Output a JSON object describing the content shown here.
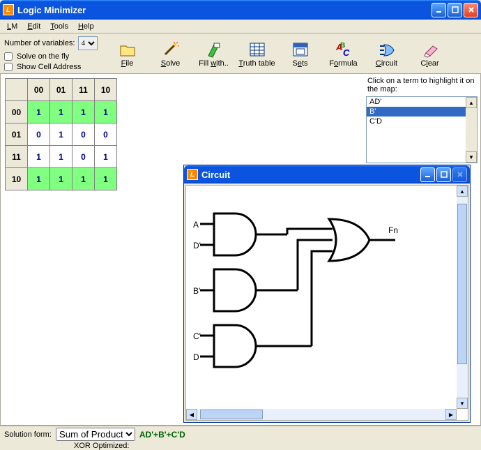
{
  "window": {
    "title": "Logic Minimizer",
    "icon_letter": "L"
  },
  "menubar": [
    "LM",
    "Edit",
    "Tools",
    "Help"
  ],
  "toolbar": {
    "num_vars_label": "Number of variables:",
    "num_vars_value": "4",
    "solve_on_fly": "Solve on the fly",
    "show_cell_addr": "Show Cell Address",
    "buttons": [
      {
        "label": "File",
        "ul": "F",
        "icon": "file-icon"
      },
      {
        "label": "Solve",
        "ul": "S",
        "icon": "wand-icon"
      },
      {
        "label": "Fill with..",
        "ul": "w",
        "icon": "marker-icon"
      },
      {
        "label": "Truth table",
        "ul": "T",
        "icon": "table-icon"
      },
      {
        "label": "Sets",
        "ul": "e",
        "icon": "sets-icon"
      },
      {
        "label": "Formula",
        "ul": "o",
        "icon": "formula-icon"
      },
      {
        "label": "Circuit",
        "ul": "C",
        "icon": "circuit-icon"
      },
      {
        "label": "Clear",
        "ul": "l",
        "icon": "eraser-icon"
      }
    ]
  },
  "kmap": {
    "col_headers": [
      "00",
      "01",
      "11",
      "10"
    ],
    "row_headers": [
      "00",
      "01",
      "11",
      "10"
    ],
    "cells": [
      [
        {
          "v": "1",
          "hl": true
        },
        {
          "v": "1",
          "hl": true
        },
        {
          "v": "1",
          "hl": true
        },
        {
          "v": "1",
          "hl": true
        }
      ],
      [
        {
          "v": "0",
          "hl": false
        },
        {
          "v": "1",
          "hl": false
        },
        {
          "v": "0",
          "hl": false
        },
        {
          "v": "0",
          "hl": false
        }
      ],
      [
        {
          "v": "1",
          "hl": false
        },
        {
          "v": "1",
          "hl": false
        },
        {
          "v": "0",
          "hl": false
        },
        {
          "v": "1",
          "hl": false
        }
      ],
      [
        {
          "v": "1",
          "hl": true
        },
        {
          "v": "1",
          "hl": true
        },
        {
          "v": "1",
          "hl": true
        },
        {
          "v": "1",
          "hl": true
        }
      ]
    ]
  },
  "terms": {
    "hint": "Click on a term to highlight it on the map:",
    "items": [
      "AD'",
      "B'",
      "C'D"
    ],
    "selected_index": 1
  },
  "circuit_window": {
    "title": "Circuit",
    "inputs_gate1": [
      "A",
      "D'"
    ],
    "input_gate2": "B'",
    "inputs_gate3": [
      "C'",
      "D"
    ],
    "output": "Fn"
  },
  "bottom": {
    "sol_form_label": "Solution form:",
    "sol_form_value": "Sum of Product",
    "formula": "AD'+B'+C'D",
    "xor_label": "XOR Optimized:"
  }
}
